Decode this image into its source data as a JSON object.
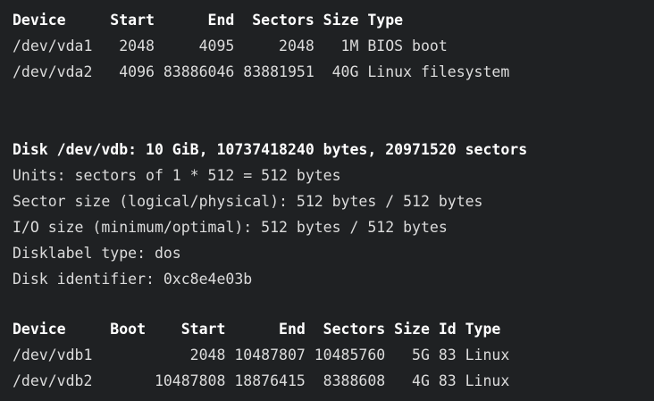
{
  "terminal": {
    "lines": [
      "Device     Start      End  Sectors Size Type",
      "/dev/vda1   2048     4095     2048   1M BIOS boot",
      "/dev/vda2   4096 83886046 83881951  40G Linux filesystem",
      "",
      "",
      "Disk /dev/vdb: 10 GiB, 10737418240 bytes, 20971520 sectors",
      "Units: sectors of 1 * 512 = 512 bytes",
      "Sector size (logical/physical): 512 bytes / 512 bytes",
      "I/O size (minimum/optimal): 512 bytes / 512 bytes",
      "Disklabel type: dos",
      "Disk identifier: 0xc8e4e03b",
      "",
      "Device     Boot    Start      End  Sectors Size Id Type",
      "/dev/vdb1           2048 10487807 10485760   5G 83 Linux",
      "/dev/vdb2       10487808 18876415  8388608   4G 83 Linux"
    ]
  },
  "colors": {
    "background": "#1f2123",
    "text": "#dcdcdc",
    "bold_text": "#ffffff"
  }
}
